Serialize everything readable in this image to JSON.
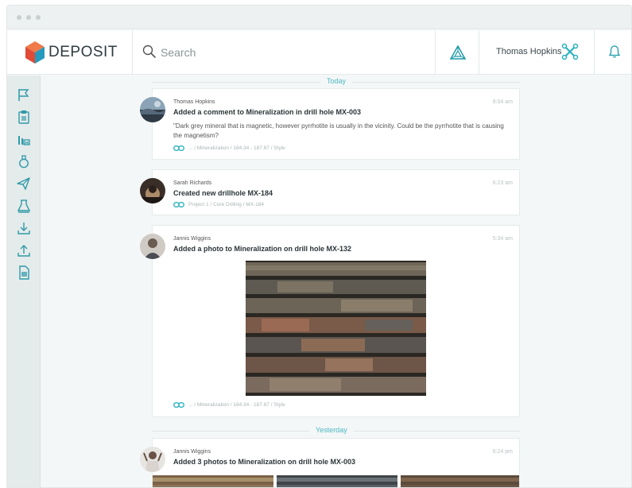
{
  "app": {
    "brand": "DEPOSIT",
    "search_placeholder": "Search",
    "user_name": "Thomas Hopkins"
  },
  "colors": {
    "accent": "#4cb8c4",
    "logo_blue": "#2aa6c9",
    "logo_orange": "#e8543a",
    "sidebar_bg": "#e4ebeb"
  },
  "sidebar": {
    "items": [
      {
        "icon": "flag-icon"
      },
      {
        "icon": "clipboard-icon"
      },
      {
        "icon": "bar-chart-icon"
      },
      {
        "icon": "flask-icon"
      },
      {
        "icon": "send-icon"
      },
      {
        "icon": "lab-beaker-icon"
      },
      {
        "icon": "download-icon"
      },
      {
        "icon": "upload-icon"
      },
      {
        "icon": "document-icon"
      }
    ]
  },
  "feed": {
    "sections": [
      {
        "label": "Today",
        "posts": [
          {
            "author": "Thomas Hopkins",
            "time": "8:04 am",
            "action": "Added a comment to Mineralization in drill hole MX-003",
            "quote": "\"Dark grey mineral that is magnetic, however pyrrhotite is usually in the vicinity. Could be the pyrrhotite that is causing the magnetism?",
            "path": "... / Mineralization / 184.34 - 187.87 / Style"
          },
          {
            "author": "Sarah Richards",
            "time": "6:23 am",
            "action": "Created new drillhole MX-184",
            "path": "Project 1 / Core Drilling / MX-184"
          },
          {
            "author": "Jannis Wiggins",
            "time": "5:34 am",
            "action": "Added a photo to Mineralization on drill hole MX-132",
            "path": "... / Mineralization / 184.34 - 187.87 / Style"
          }
        ]
      },
      {
        "label": "Yesterday",
        "posts": [
          {
            "author": "Jannis Wiggins",
            "time": "6:24 pm",
            "action": "Added 3 photos to Mineralization on drill hole MX-003"
          }
        ]
      }
    ]
  }
}
